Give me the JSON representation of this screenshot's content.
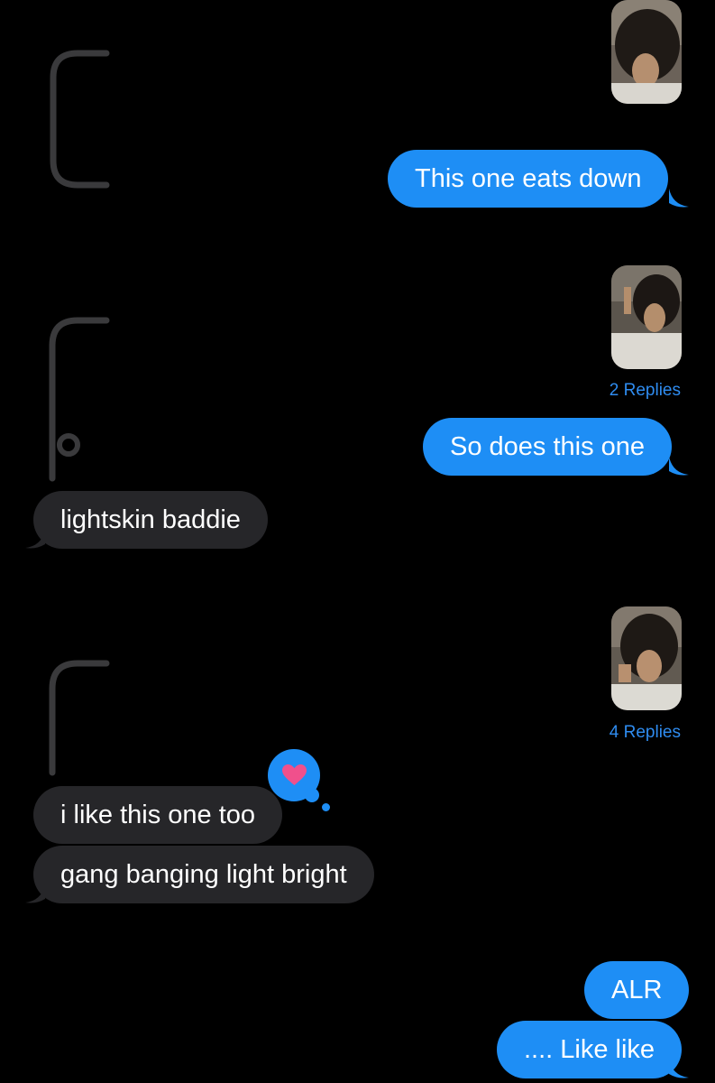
{
  "messages": {
    "sent_1": "This one eats down",
    "sent_2": "So does this one",
    "recv_1": "lightskin baddie",
    "recv_2": "i like this one too",
    "recv_3": "gang banging light bright",
    "sent_3": "ALR",
    "sent_4": ".... Like like"
  },
  "replies": {
    "photo_2": "2 Replies",
    "photo_3": "4 Replies"
  },
  "reaction": {
    "icon": "heart-icon",
    "color": "#f0508c"
  },
  "colors": {
    "sent_bubble": "#1e8ef5",
    "received_bubble": "#262629",
    "reply_link": "#2f8cf0",
    "background": "#000000"
  }
}
